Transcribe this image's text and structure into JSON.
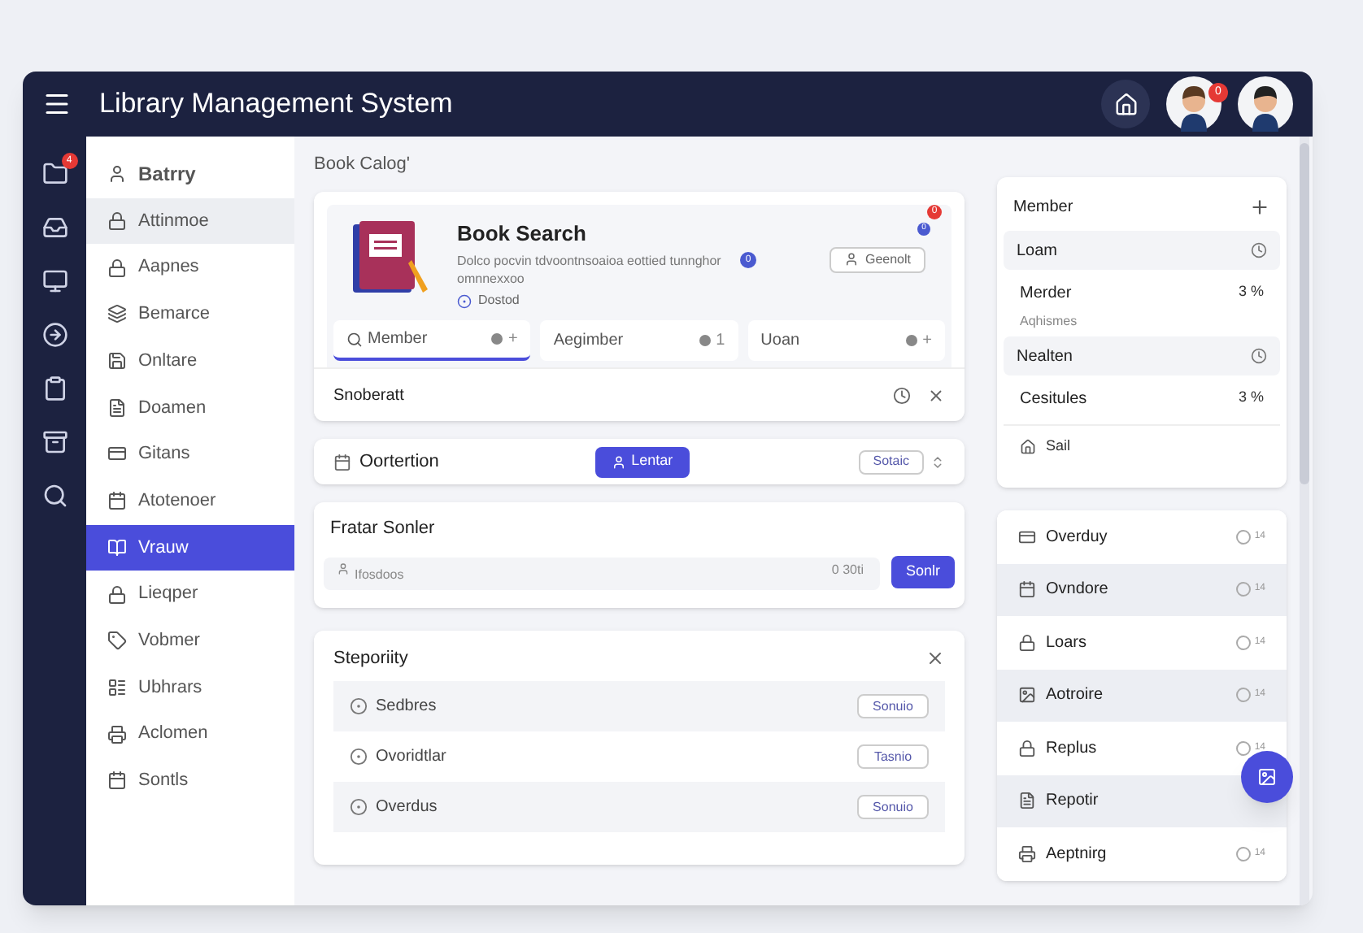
{
  "window": {
    "title": "Library Management System"
  },
  "header": {
    "avatar_badge": "0"
  },
  "rail": {
    "badge": "4"
  },
  "sidebar": {
    "items": [
      {
        "label": "Batrry",
        "selected": false,
        "highlighted": false,
        "kind": "heading"
      },
      {
        "label": "Attinmoe",
        "selected": false,
        "highlighted": true,
        "kind": "item"
      },
      {
        "label": "Aapnes",
        "selected": false,
        "highlighted": false,
        "kind": "item"
      },
      {
        "label": "Bemarce",
        "selected": false,
        "highlighted": false,
        "kind": "item"
      },
      {
        "label": "Onltare",
        "selected": false,
        "highlighted": false,
        "kind": "item"
      },
      {
        "label": "Doamen",
        "selected": false,
        "highlighted": false,
        "kind": "item"
      },
      {
        "label": "Gitans",
        "selected": false,
        "highlighted": false,
        "kind": "item"
      },
      {
        "label": "Atotenoer",
        "selected": false,
        "highlighted": false,
        "kind": "item"
      },
      {
        "label": "Vrauw",
        "selected": true,
        "highlighted": false,
        "kind": "item"
      },
      {
        "label": "Lieqper",
        "selected": false,
        "highlighted": false,
        "kind": "item"
      },
      {
        "label": "Vobmer",
        "selected": false,
        "highlighted": false,
        "kind": "item"
      },
      {
        "label": "Ubhrars",
        "selected": false,
        "highlighted": false,
        "kind": "item"
      },
      {
        "label": "Aclomen",
        "selected": false,
        "highlighted": false,
        "kind": "item"
      },
      {
        "label": "Sontls",
        "selected": false,
        "highlighted": false,
        "kind": "item"
      }
    ]
  },
  "breadcrumb": "Book Calog'",
  "search_card": {
    "title": "Book Search",
    "description": "Dolco pocvin tdvoontnsoaioa eottied tunnghor omnnexxoo",
    "description_badge": "0",
    "status": "Dostod",
    "button": "Geenolt",
    "badge_red": "0",
    "badge_blue": "0",
    "tabs": [
      {
        "label": "Member",
        "count": "+",
        "selected": true
      },
      {
        "label": "Aegimber",
        "count": "1",
        "selected": false
      },
      {
        "label": "Uoan",
        "count": "+",
        "selected": false
      }
    ],
    "footer": "Snoberatt"
  },
  "option_card": {
    "label": "Oortertion",
    "primary_button": "Lentar",
    "secondary_button": "Sotaic"
  },
  "filter_card": {
    "title": "Fratar Sonler",
    "placeholder": "Ifosdoos",
    "hint": "0 30ti",
    "button": "Sonlr"
  },
  "list_card": {
    "title": "Steporiity",
    "rows": [
      {
        "label": "Sedbres",
        "button": "Sonuio",
        "shaded": true
      },
      {
        "label": "Ovoridtlar",
        "button": "Tasnio",
        "shaded": false
      },
      {
        "label": "Overdus",
        "button": "Sonuio",
        "shaded": true
      }
    ]
  },
  "member_card": {
    "title": "Member",
    "rows": [
      {
        "kind": "action",
        "label": "Loam"
      },
      {
        "kind": "stat",
        "label": "Merder",
        "value": "3 %"
      },
      {
        "kind": "note",
        "label": "Aqhismes"
      },
      {
        "kind": "action",
        "label": "Nealten"
      },
      {
        "kind": "stat",
        "label": "Cesitules",
        "value": "3 %"
      },
      {
        "kind": "link",
        "label": "Sail"
      }
    ]
  },
  "status_list": [
    {
      "label": "Overduy",
      "count": "14",
      "shaded": false
    },
    {
      "label": "Ovndore",
      "count": "14",
      "shaded": true
    },
    {
      "label": "Loars",
      "count": "14",
      "shaded": false
    },
    {
      "label": "Aotroire",
      "count": "14",
      "shaded": true
    },
    {
      "label": "Replus",
      "count": "14",
      "shaded": false
    },
    {
      "label": "Repotir",
      "shaded": true
    },
    {
      "label": "Aeptnirg",
      "count": "14",
      "shaded": false
    }
  ]
}
